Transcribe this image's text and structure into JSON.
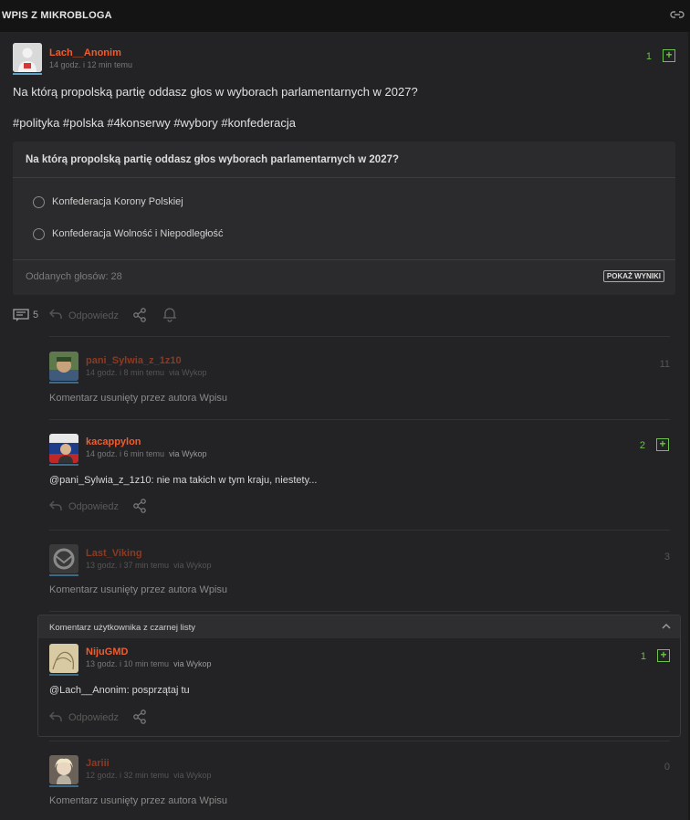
{
  "header": {
    "title": "WPIS Z MIKROBLOGA",
    "link_icon": "link-icon"
  },
  "post": {
    "author": "Lach__Anonim",
    "time": "14 godz. i 12 min temu",
    "votes": "1",
    "text": "Na którą propolską partię oddasz głos w wyborach parlamentarnych w 2027?",
    "tags": "#polityka #polska #4konserwy #wybory #konfederacja",
    "comment_count": "5",
    "reply_label": "Odpowiedz"
  },
  "poll": {
    "question": "Na którą propolską partię oddasz głos wyborach parlamentarnych w 2027?",
    "options": [
      "Konfederacja Korony Polskiej",
      "Konfederacja Wolność i Niepodległość"
    ],
    "votes_cast": "Oddanych głosów: 28",
    "show_results": "POKAŻ WYNIKI"
  },
  "comments": [
    {
      "author": "pani_Sylwia_z_1z10",
      "time": "14 godz. i 8 min temu",
      "via": "via Wykop",
      "votes": "11",
      "text": "Komentarz usunięty przez autora Wpisu"
    },
    {
      "author": "kacappylon",
      "time": "14 godz. i 6 min temu",
      "via": "via Wykop",
      "votes": "2",
      "mention": "@pani_Sylwia_z_1z10",
      "text": ": nie ma takich w tym kraju, niestety...",
      "reply_label": "Odpowiedz"
    },
    {
      "author": "Last_Viking",
      "time": "13 godz. i 37 min temu",
      "via": "via Wykop",
      "votes": "3",
      "text": "Komentarz usunięty przez autora Wpisu"
    },
    {
      "author": "NijuGMD",
      "time": "13 godz. i 10 min temu",
      "via": "via Wykop",
      "votes": "1",
      "mention": "@Lach__Anonim",
      "text": ": posprzątaj tu",
      "reply_label": "Odpowiedz"
    },
    {
      "author": "Jariii",
      "time": "12 godz. i 32 min temu",
      "via": "via Wykop",
      "votes": "0",
      "text": "Komentarz usunięty przez autora Wpisu"
    }
  ],
  "blacklist": {
    "label": "Komentarz użytkownika z czarnej listy"
  },
  "colors": {
    "accent": "#f05c2e",
    "vote_green": "#6cc24a",
    "background": "#232325"
  }
}
